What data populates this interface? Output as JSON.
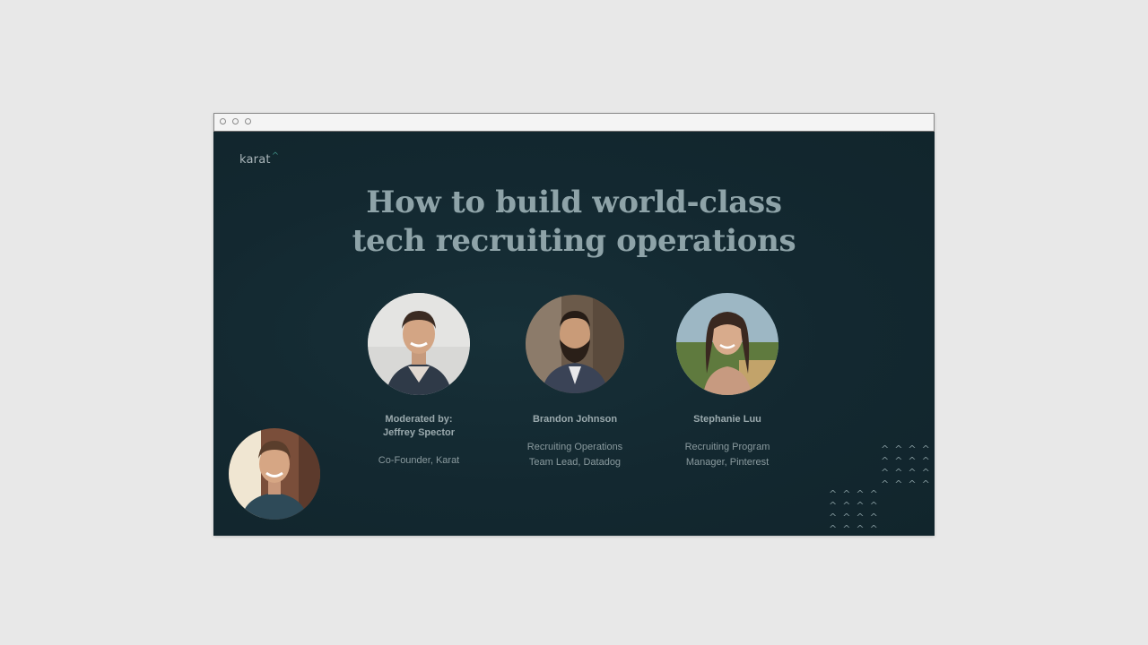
{
  "window": {
    "controls": [
      "close-dot",
      "minimize-dot",
      "maximize-dot"
    ]
  },
  "slide": {
    "logo": "karat",
    "title_line1": "How to build world-class",
    "title_line2": "tech recruiting operations",
    "speakers": [
      {
        "name_line1": "Moderated by:",
        "name_line2": "Jeffrey Spector",
        "role_line1": "Co-Founder, Karat",
        "role_line2": ""
      },
      {
        "name_line1": "Brandon Johnson",
        "name_line2": "",
        "role_line1": "Recruiting Operations",
        "role_line2": "Team Lead, Datadog"
      },
      {
        "name_line1": "Stephanie Luu",
        "name_line2": "",
        "role_line1": "Recruiting Program",
        "role_line2": "Manager, Pinterest"
      }
    ]
  },
  "colors": {
    "background": "#e8e8e8",
    "slide": "#14282f",
    "title": "#8ea3a8",
    "accent": "#3f8f85"
  }
}
